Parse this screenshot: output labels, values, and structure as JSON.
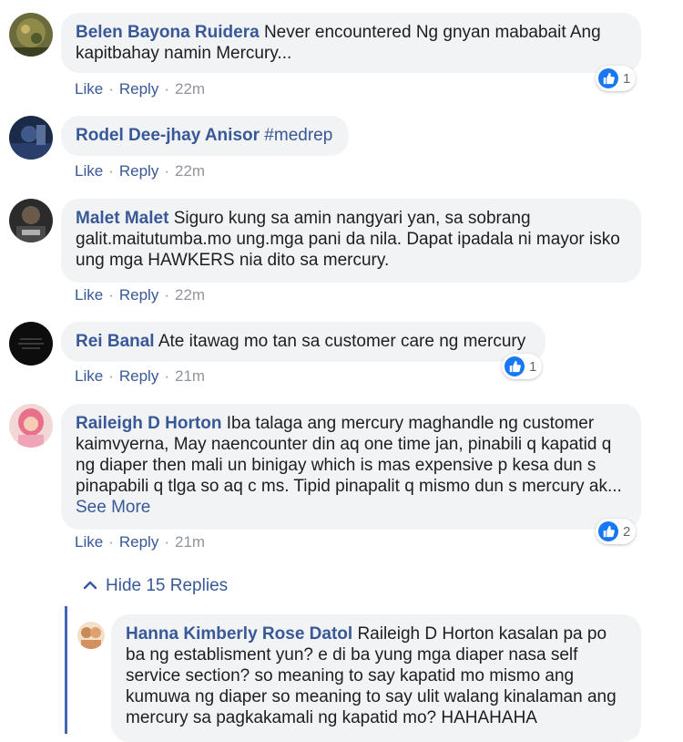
{
  "actions": {
    "like": "Like",
    "reply": "Reply",
    "separator": "·"
  },
  "comments": [
    {
      "author": "Belen Bayona Ruidera",
      "text": "Never encountered Ng gnyan mababait Ang kapitbahay namin Mercury...",
      "time": "22m",
      "reactions": "1"
    },
    {
      "author": "Rodel Dee-jhay Anisor",
      "text": "#medrep",
      "time": "22m"
    },
    {
      "author": "Malet Malet",
      "text": "Siguro kung sa amin nangyari yan, sa sobrang galit.maitutumba.mo ung.mga pani da nila. Dapat ipadala ni mayor isko ung mga HAWKERS nia dito sa mercury.",
      "time": "22m"
    },
    {
      "author": "Rei Banal",
      "text": "Ate itawag mo tan sa customer care ng mercury",
      "time": "21m",
      "reactions": "1"
    },
    {
      "author": "Raileigh D Horton",
      "text": "Iba talaga ang mercury maghandle ng customer kaimvyerna, May naencounter din aq one time jan, pinabili q kapatid q ng diaper then mali un binigay which is mas expensive p kesa dun s pinapabili q tlga so aq c ms. Tipid pinapalit q mismo dun s mercury ak...",
      "see_more": "See More",
      "time": "21m",
      "reactions": "2"
    }
  ],
  "hide_replies": "Hide 15 Replies",
  "reply": {
    "author": "Hanna Kimberly Rose Datol",
    "text": "Raileigh D Horton kasalan pa po ba ng establisment yun? e di ba yung mga diaper nasa self service section? so meaning to say kapatid mo mismo ang kumuwa ng diaper so meaning to say ulit walang kinalaman ang mercury sa pagkakamali ng kapatid mo? HAHAHAHA"
  },
  "colors": {
    "link": "#385898",
    "bubble": "#f2f3f5",
    "like_blue": "#1877f2",
    "thread": "#4267b2"
  },
  "icons": [
    "thumbs-up-icon",
    "chevron-up-icon"
  ]
}
